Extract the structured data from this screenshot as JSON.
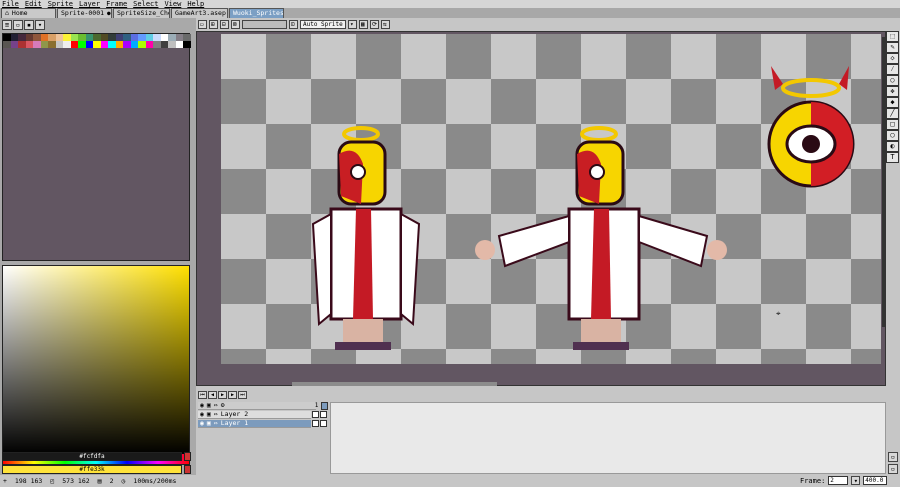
{
  "menu": [
    "File",
    "Edit",
    "Sprite",
    "Layer",
    "Frame",
    "Select",
    "View",
    "Help"
  ],
  "tabs": [
    {
      "label": "Home",
      "active": false,
      "closable": false
    },
    {
      "label": "Sprite-0001",
      "active": false,
      "closable": true
    },
    {
      "label": "SpriteSize_Che",
      "active": false,
      "closable": true
    },
    {
      "label": "GameArt3.asep",
      "active": false,
      "closable": true
    },
    {
      "label": "Wuoki_Sprites",
      "active": true,
      "closable": true
    }
  ],
  "editor": {
    "layer_select": "Auto Sprite"
  },
  "colors": {
    "foreground_label": "#fcfdfa",
    "background_label": "#ffe33k"
  },
  "layers": [
    {
      "name": "Layer 2",
      "selected": false
    },
    {
      "name": "Layer 1",
      "selected": true
    }
  ],
  "frame_header": "1",
  "status": {
    "position": "198 163",
    "size": "573 162",
    "frame_info": "2",
    "duration": "100ms/200ms"
  },
  "frame": {
    "label": "Frame:",
    "value": "2",
    "zoom": "400.0"
  },
  "icons": {
    "right_tools": [
      "marquee-icon",
      "pencil-icon",
      "eraser-icon",
      "eyedropper-icon",
      "zoom-icon",
      "move-icon",
      "fill-icon",
      "line-icon",
      "rect-icon",
      "ellipse-icon",
      "blur-icon",
      "text-icon"
    ]
  }
}
